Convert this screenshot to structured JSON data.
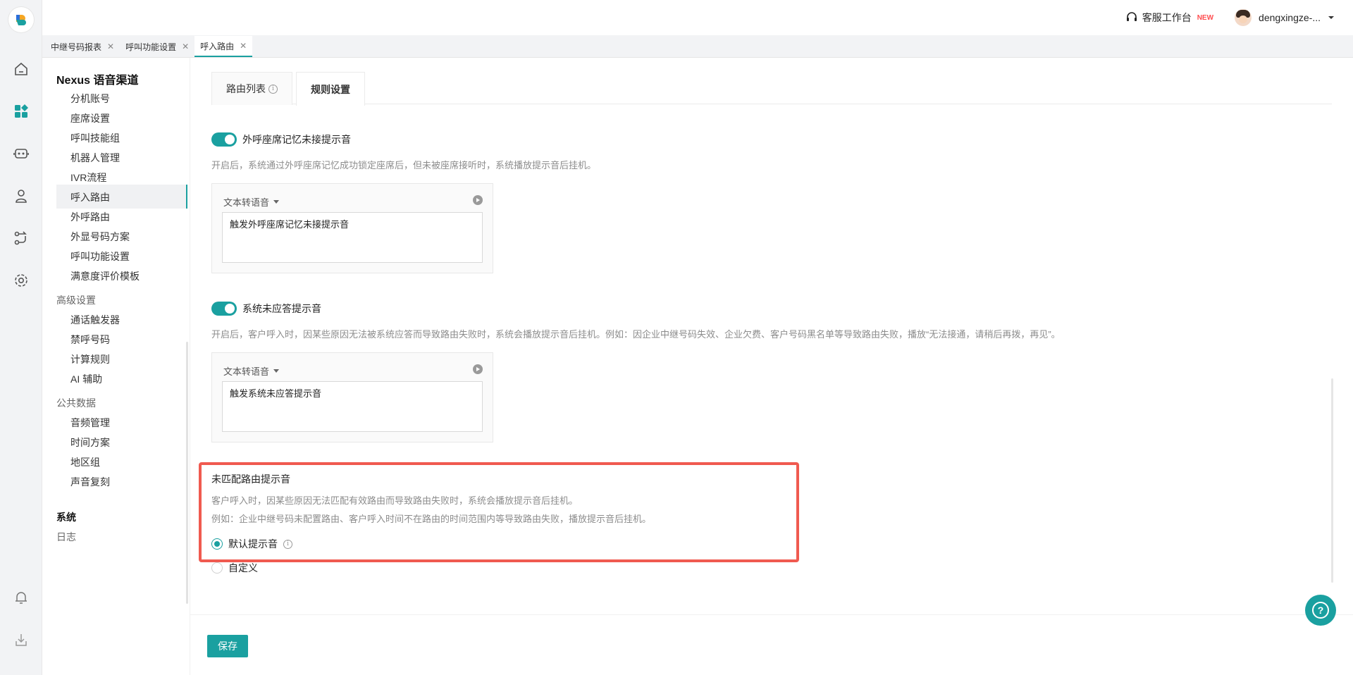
{
  "header": {
    "workspace_label": "客服工作台",
    "new_badge": "NEW",
    "username": "dengxingze-..."
  },
  "page_tabs": [
    {
      "label": "中继号码报表"
    },
    {
      "label": "呼叫功能设置"
    },
    {
      "label": "呼入路由"
    }
  ],
  "sidebar": {
    "title": "Nexus 语音渠道",
    "items": [
      {
        "label": "分机账号"
      },
      {
        "label": "座席设置"
      },
      {
        "label": "呼叫技能组"
      },
      {
        "label": "机器人管理"
      },
      {
        "label": "IVR流程"
      },
      {
        "label": "呼入路由"
      },
      {
        "label": "外呼路由"
      },
      {
        "label": "外显号码方案"
      },
      {
        "label": "呼叫功能设置"
      },
      {
        "label": "满意度评价模板"
      }
    ],
    "groups": [
      {
        "title": "高级设置",
        "items": [
          "通话触发器",
          "禁呼号码",
          "计算规则",
          "AI 辅助"
        ]
      },
      {
        "title": "公共数据",
        "items": [
          "音频管理",
          "时间方案",
          "地区组",
          "声音复刻"
        ]
      }
    ],
    "system_title": "系统",
    "system_items": [
      "日志"
    ]
  },
  "sub_tabs": {
    "route_list": "路由列表",
    "rule_settings": "规则设置"
  },
  "sections": {
    "outbound_memory": {
      "label": "外呼座席记忆未接提示音",
      "description": "开启后，系统通过外呼座席记忆成功锁定座席后，但未被座席接听时，系统播放提示音后挂机。",
      "tts_label": "文本转语音",
      "tts_value": "触发外呼座席记忆未接提示音",
      "enabled": true
    },
    "system_no_answer": {
      "label": "系统未应答提示音",
      "description": "开启后，客户呼入时，因某些原因无法被系统应答而导致路由失败时，系统会播放提示音后挂机。例如：因企业中继号码失效、企业欠费、客户号码黑名单等导致路由失败，播放“无法接通，请稍后再拨，再见”。",
      "tts_label": "文本转语音",
      "tts_value": "触发系统未应答提示音",
      "enabled": true
    },
    "unmatched_route": {
      "title": "未匹配路由提示音",
      "description1": "客户呼入时，因某些原因无法匹配有效路由而导致路由失败时，系统会播放提示音后挂机。",
      "description2": "例如：企业中继号码未配置路由、客户呼入时间不在路由的时间范围内等导致路由失败，播放提示音后挂机。",
      "option_default": "默认提示音",
      "option_custom": "自定义",
      "selected": "默认提示音"
    }
  },
  "footer": {
    "save_label": "保存"
  },
  "colors": {
    "accent": "#1aa0a0",
    "highlight_border": "#f05a50"
  }
}
